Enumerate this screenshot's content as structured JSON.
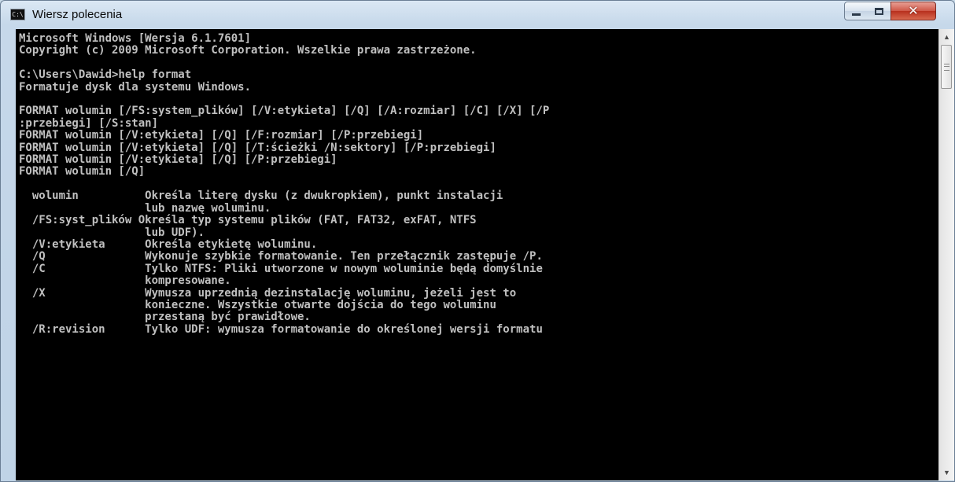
{
  "window": {
    "title": "Wiersz polecenia",
    "icon": "cmd-icon",
    "icon_text": "C:\\",
    "controls": {
      "minimize": "minimize-icon",
      "maximize": "maximize-icon",
      "close": "close-icon",
      "close_glyph": "✕"
    }
  },
  "console": {
    "text": "Microsoft Windows [Wersja 6.1.7601]\nCopyright (c) 2009 Microsoft Corporation. Wszelkie prawa zastrzeżone.\n\nC:\\Users\\Dawid>help format\nFormatuje dysk dla systemu Windows.\n\nFORMAT wolumin [/FS:system_plików] [/V:etykieta] [/Q] [/A:rozmiar] [/C] [/X] [/P\n:przebiegi] [/S:stan]\nFORMAT wolumin [/V:etykieta] [/Q] [/F:rozmiar] [/P:przebiegi]\nFORMAT wolumin [/V:etykieta] [/Q] [/T:ścieżki /N:sektory] [/P:przebiegi]\nFORMAT wolumin [/V:etykieta] [/Q] [/P:przebiegi]\nFORMAT wolumin [/Q]\n\n  wolumin          Określa literę dysku (z dwukropkiem), punkt instalacji\n                   lub nazwę woluminu.\n  /FS:syst_plików Określa typ systemu plików (FAT, FAT32, exFAT, NTFS\n                   lub UDF).\n  /V:etykieta      Określa etykietę woluminu.\n  /Q               Wykonuje szybkie formatowanie. Ten przełącznik zastępuje /P.\n  /C               Tylko NTFS: Pliki utworzone w nowym woluminie będą domyślnie\n                   kompresowane.\n  /X               Wymusza uprzednią dezinstalację woluminu, jeżeli jest to\n                   konieczne. Wszystkie otwarte dojścia do tego woluminu\n                   przestaną być prawidłowe.\n  /R:revision      Tylko UDF: wymusza formatowanie do określonej wersji formatu"
  },
  "scrollbar": {
    "up_arrow": "▲",
    "down_arrow": "▼",
    "position": 0
  }
}
